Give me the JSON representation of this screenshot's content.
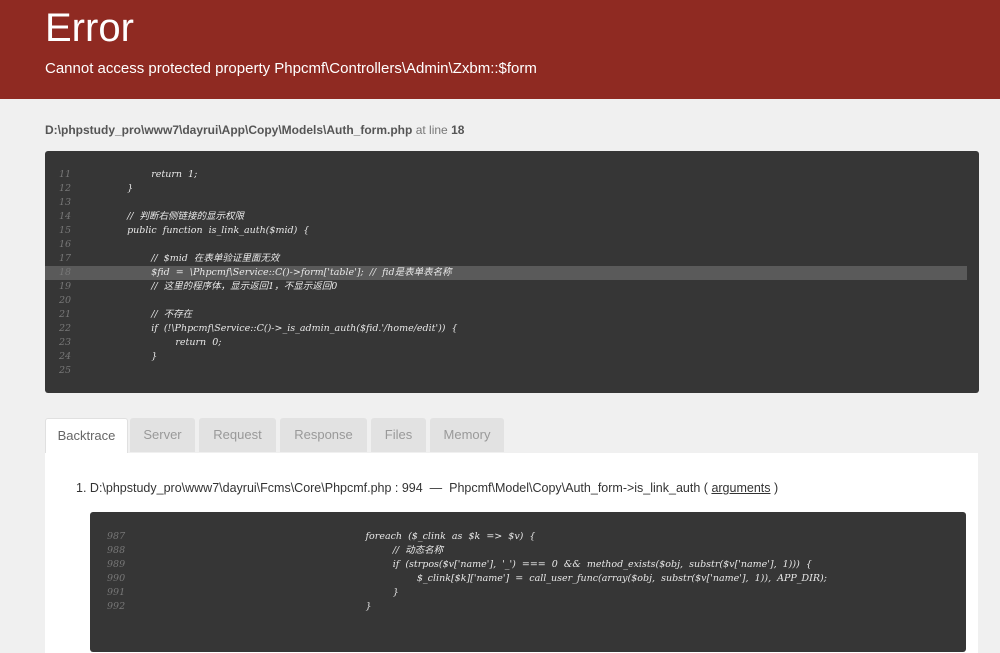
{
  "header": {
    "title": "Error",
    "message": "Cannot access protected property Phpcmf\\Controllers\\Admin\\Zxbm::$form"
  },
  "source": {
    "file": "D:\\phpstudy_pro\\www7\\dayrui\\App\\Copy\\Models\\Auth_form.php",
    "at_text": "at line",
    "line": "18"
  },
  "code": {
    "lines": [
      {
        "num": "11",
        "text": "            return  1;"
      },
      {
        "num": "12",
        "text": "    }"
      },
      {
        "num": "13",
        "text": ""
      },
      {
        "num": "14",
        "text": "    //  判断右侧链接的显示权限"
      },
      {
        "num": "15",
        "text": "    public  function  is_link_auth($mid)  {"
      },
      {
        "num": "16",
        "text": ""
      },
      {
        "num": "17",
        "text": "            //  $mid  在表单验证里面无效"
      },
      {
        "num": "18",
        "text": "            $fid  =  \\Phpcmf\\Service::C()->form['table'];  //  fid是表单表名称"
      },
      {
        "num": "19",
        "text": "            //  这里的程序体，显示返回1，不显示返回0"
      },
      {
        "num": "20",
        "text": ""
      },
      {
        "num": "21",
        "text": "            //  不存在"
      },
      {
        "num": "22",
        "text": "            if  (!\\Phpcmf\\Service::C()->_is_admin_auth($fid.'/home/edit'))  {"
      },
      {
        "num": "23",
        "text": "                    return  0;"
      },
      {
        "num": "24",
        "text": "            }"
      },
      {
        "num": "25",
        "text": ""
      }
    ]
  },
  "tabs": [
    {
      "label": "Backtrace"
    },
    {
      "label": "Server"
    },
    {
      "label": "Request"
    },
    {
      "label": "Response"
    },
    {
      "label": "Files"
    },
    {
      "label": "Memory"
    }
  ],
  "backtrace": {
    "index": "1.",
    "file": "D:\\phpstudy_pro\\www7\\dayrui\\Fcms\\Core\\Phpcmf.php",
    "line": "994",
    "separator": "—",
    "func": "Phpcmf\\Model\\Copy\\Auth_form->is_link_auth",
    "paren_open": "(",
    "args_label": "arguments",
    "paren_close": ")",
    "code_lines": [
      {
        "num": "987",
        "text": "                                                                              foreach  ($_clink  as  $k  =>  $v)  {"
      },
      {
        "num": "988",
        "text": "                                                                                       //  动态名称"
      },
      {
        "num": "989",
        "text": "                                                                                       if  (strpos($v['name'],  '_')  ===  0  &&  method_exists($obj,  substr($v['name'],  1)))  {"
      },
      {
        "num": "990",
        "text": "                                                                                               $_clink[$k]['name']  =  call_user_func(array($obj,  substr($v['name'],  1)),  APP_DIR);"
      },
      {
        "num": "991",
        "text": "                                                                                       }"
      },
      {
        "num": "992",
        "text": "                                                                              }"
      }
    ]
  }
}
